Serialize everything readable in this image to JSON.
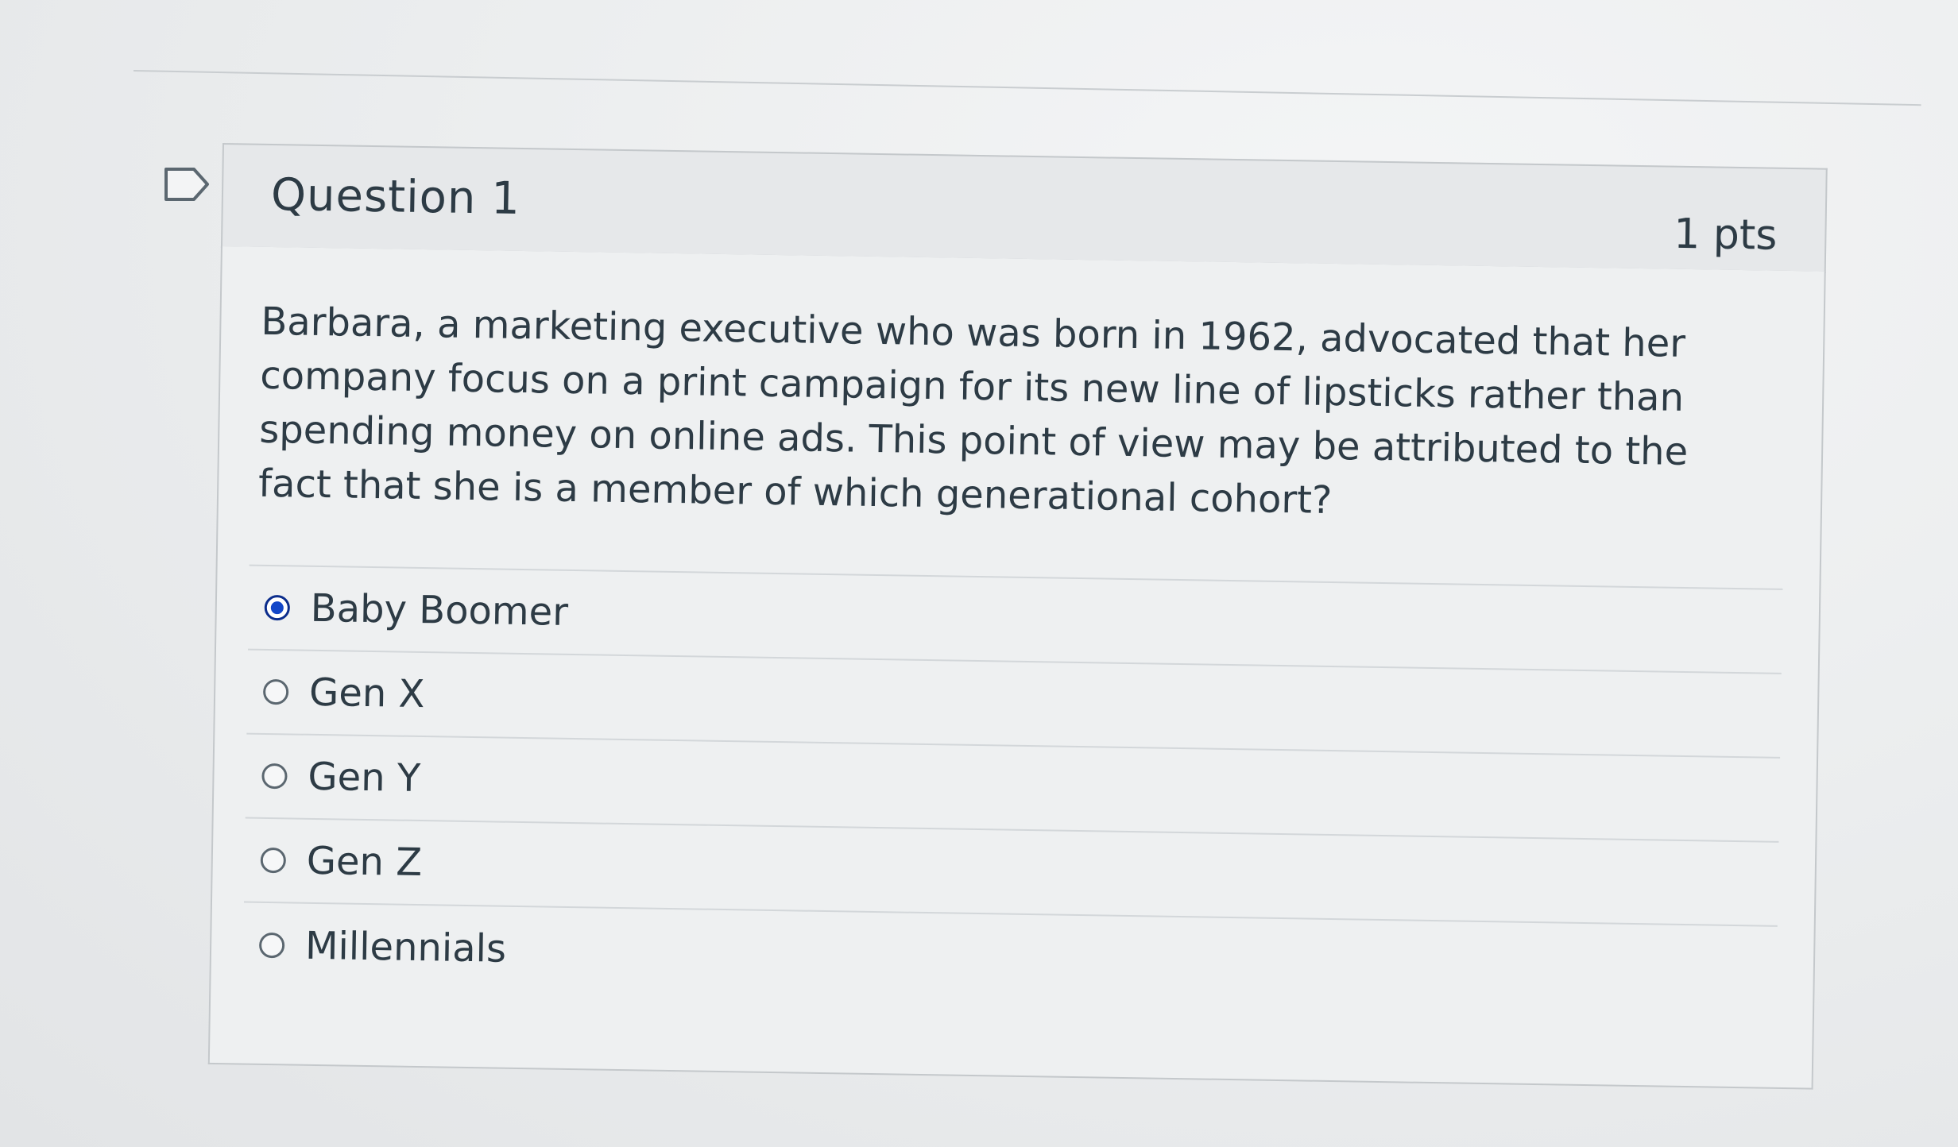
{
  "question": {
    "title": "Question 1",
    "points": "1 pts",
    "text": "Barbara, a marketing executive who was born in 1962, advocated that her company focus on a print campaign for its new line of lipsticks rather than spending money on online ads. This point of view may be attributed to the fact that she is a member of which generational cohort?",
    "flag_icon": "bookmark-flag-icon"
  },
  "answers": [
    {
      "label": "Baby Boomer",
      "selected": true
    },
    {
      "label": "Gen X",
      "selected": false
    },
    {
      "label": "Gen Y",
      "selected": false
    },
    {
      "label": "Gen Z",
      "selected": false
    },
    {
      "label": "Millennials",
      "selected": false
    }
  ],
  "colors": {
    "selected_radio": "#1246c8",
    "text": "#2d3b45",
    "header_bg": "#e6e8ea"
  }
}
